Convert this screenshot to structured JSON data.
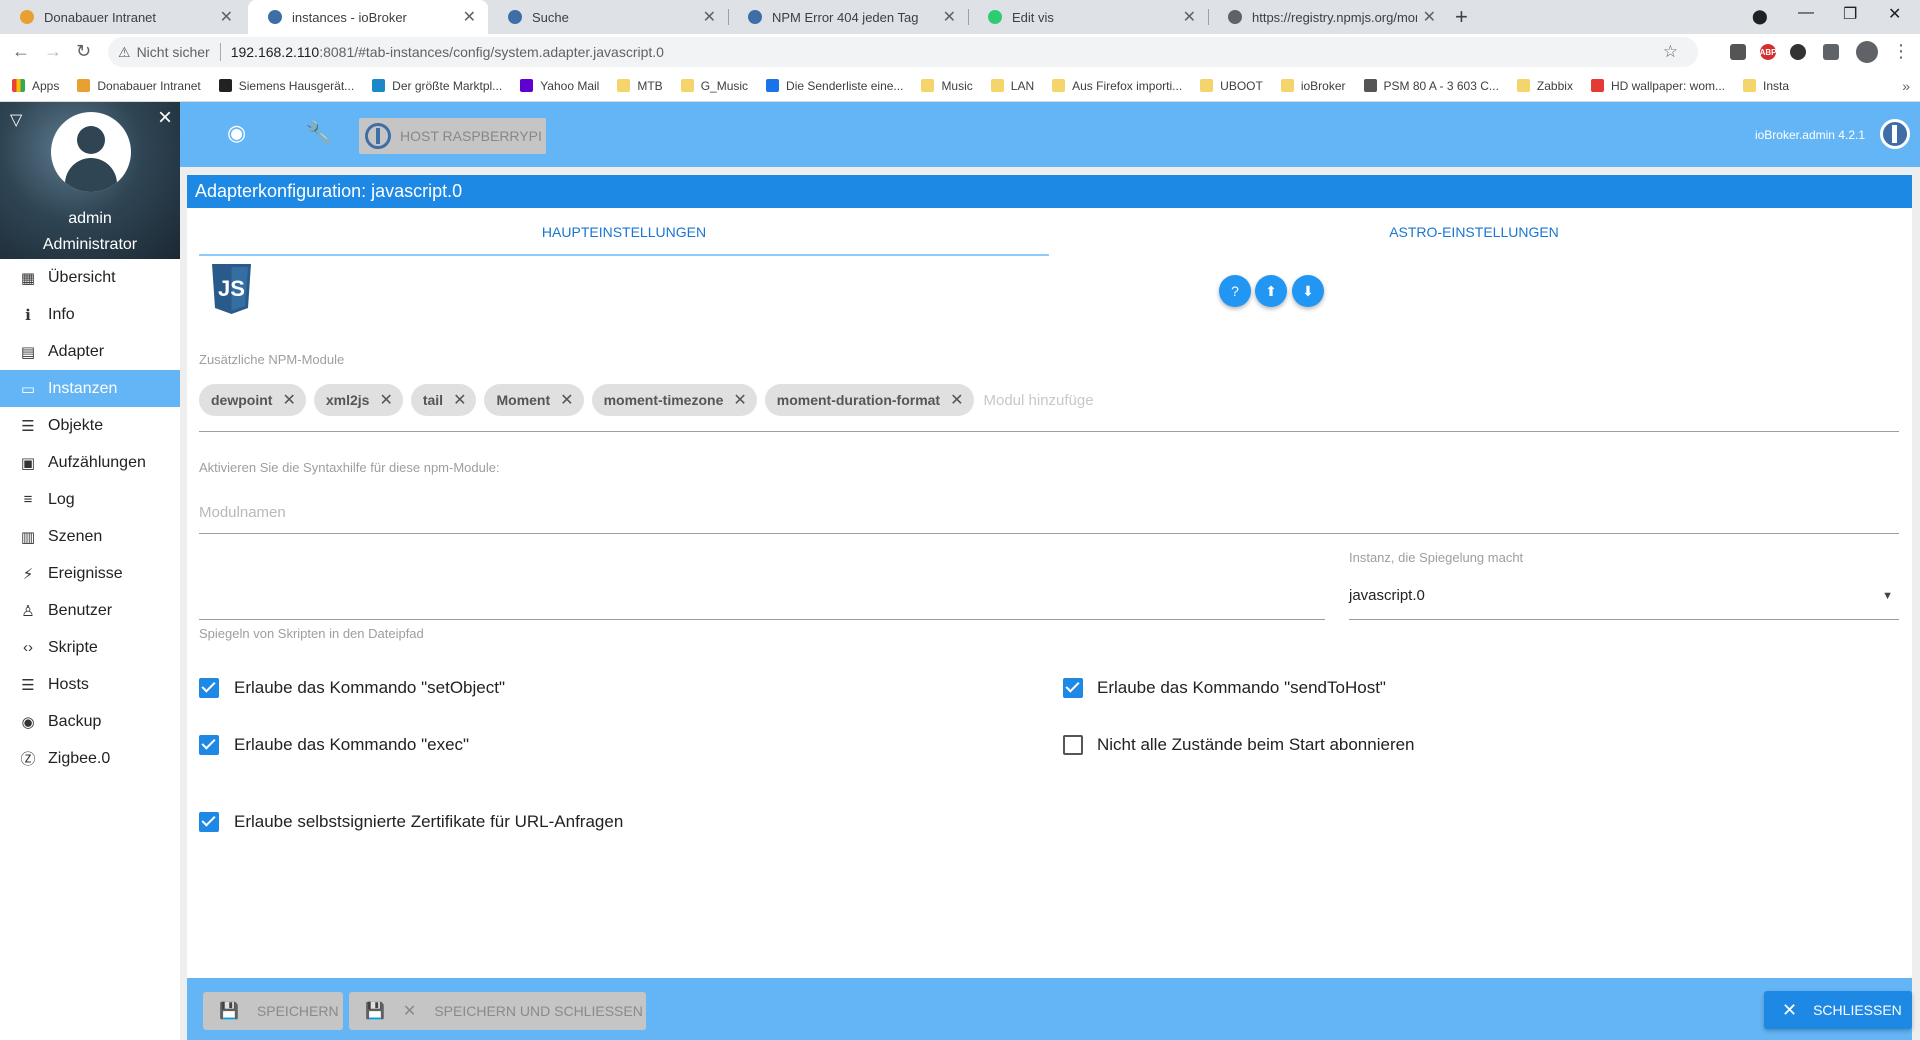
{
  "browser": {
    "tabs": [
      {
        "label": "Donabauer Intranet",
        "favicon_color": "#e8a032"
      },
      {
        "label": "instances - ioBroker",
        "favicon_color": "#3f6ea6"
      },
      {
        "label": "Suche",
        "favicon_color": "#3f6ea6"
      },
      {
        "label": "NPM Error 404 jeden Tag",
        "favicon_color": "#3f6ea6"
      },
      {
        "label": "Edit vis",
        "favicon_color": "#2ecc71"
      },
      {
        "label": "https://registry.npmjs.org/mome",
        "favicon_color": "#5f6368"
      }
    ],
    "address": {
      "security": "Nicht sicher",
      "host": "192.168.2.110",
      "path": ":8081/#tab-instances/config/system.adapter.javascript.0"
    },
    "bookmarks": [
      {
        "label": "Apps",
        "type": "apps"
      },
      {
        "label": "Donabauer Intranet",
        "type": "site",
        "color": "#e8a032"
      },
      {
        "label": "Siemens Hausgerät...",
        "type": "site",
        "color": "#222"
      },
      {
        "label": "Der größte Marktpl...",
        "type": "site",
        "color": "#1b88c9"
      },
      {
        "label": "Yahoo Mail",
        "type": "site",
        "color": "#6001d2"
      },
      {
        "label": "MTB",
        "type": "folder"
      },
      {
        "label": "G_Music",
        "type": "folder"
      },
      {
        "label": "Die Senderliste eine...",
        "type": "site",
        "color": "#1a73e8"
      },
      {
        "label": "Music",
        "type": "folder"
      },
      {
        "label": "LAN",
        "type": "folder"
      },
      {
        "label": "Aus Firefox importi...",
        "type": "folder"
      },
      {
        "label": "UBOOT",
        "type": "folder"
      },
      {
        "label": "ioBroker",
        "type": "folder"
      },
      {
        "label": "PSM 80 A - 3 603 C...",
        "type": "site",
        "color": "#555"
      },
      {
        "label": "Zabbix",
        "type": "folder"
      },
      {
        "label": "HD wallpaper: wom...",
        "type": "site",
        "color": "#e53935"
      },
      {
        "label": "Insta",
        "type": "folder"
      }
    ]
  },
  "sidebar": {
    "user": "admin",
    "role": "Administrator",
    "items": [
      {
        "label": "Übersicht",
        "icon": "grid-icon",
        "glyph": "▦"
      },
      {
        "label": "Info",
        "icon": "info-icon",
        "glyph": "ℹ"
      },
      {
        "label": "Adapter",
        "icon": "store-icon",
        "glyph": "▤"
      },
      {
        "label": "Instanzen",
        "icon": "instances-icon",
        "glyph": "▭",
        "active": true
      },
      {
        "label": "Objekte",
        "icon": "list-icon",
        "glyph": "☰"
      },
      {
        "label": "Aufzählungen",
        "icon": "enum-icon",
        "glyph": "▣"
      },
      {
        "label": "Log",
        "icon": "log-icon",
        "glyph": "≡"
      },
      {
        "label": "Szenen",
        "icon": "scenes-icon",
        "glyph": "▥"
      },
      {
        "label": "Ereignisse",
        "icon": "bolt-icon",
        "glyph": "⚡"
      },
      {
        "label": "Benutzer",
        "icon": "user-icon",
        "glyph": "♙"
      },
      {
        "label": "Skripte",
        "icon": "code-icon",
        "glyph": "‹›"
      },
      {
        "label": "Hosts",
        "icon": "hosts-icon",
        "glyph": "☰"
      },
      {
        "label": "Backup",
        "icon": "backup-icon",
        "glyph": "◉"
      },
      {
        "label": "Zigbee.0",
        "icon": "zigbee-icon",
        "glyph": "Ⓩ"
      }
    ]
  },
  "toolbar": {
    "host_label": "HOST RASPBERRYPI",
    "version": "ioBroker.admin 4.2.1"
  },
  "dialog": {
    "title": "Adapterkonfiguration: javascript.0",
    "tabs": [
      "HAUPTEINSTELLUNGEN",
      "ASTRO-EINSTELLUNGEN"
    ],
    "npm_label": "Zusätzliche NPM-Module",
    "npm_modules": [
      "dewpoint",
      "xml2js",
      "tail",
      "Moment",
      "moment-timezone",
      "moment-duration-format"
    ],
    "npm_placeholder": "Modul hinzufüge",
    "syntax_label": "Aktivieren Sie die Syntaxhilfe für diese npm-Module:",
    "syntax_placeholder": "Modulnamen",
    "mirror_label": "Spiegeln von Skripten in den Dateipfad",
    "mirror_instance_label": "Instanz, die Spiegelung macht",
    "mirror_instance_value": "javascript.0",
    "checkboxes": [
      {
        "label": "Erlaube das Kommando \"setObject\"",
        "checked": true
      },
      {
        "label": "Erlaube das Kommando \"exec\"",
        "checked": true
      },
      {
        "label": "Erlaube selbstsignierte Zertifikate für URL-Anfragen",
        "checked": true
      },
      {
        "label": "Erlaube das Kommando \"sendToHost\"",
        "checked": true
      },
      {
        "label": "Nicht alle Zustände beim Start abonnieren",
        "checked": false
      }
    ]
  },
  "footer": {
    "save": "SPEICHERN",
    "save_close": "SPEICHERN UND SCHLIESSEN",
    "close": "SCHLIESSEN"
  },
  "colors": {
    "primary": "#1e88e5",
    "toolbar": "#64b5f6",
    "active_nav": "#64b5f6"
  }
}
